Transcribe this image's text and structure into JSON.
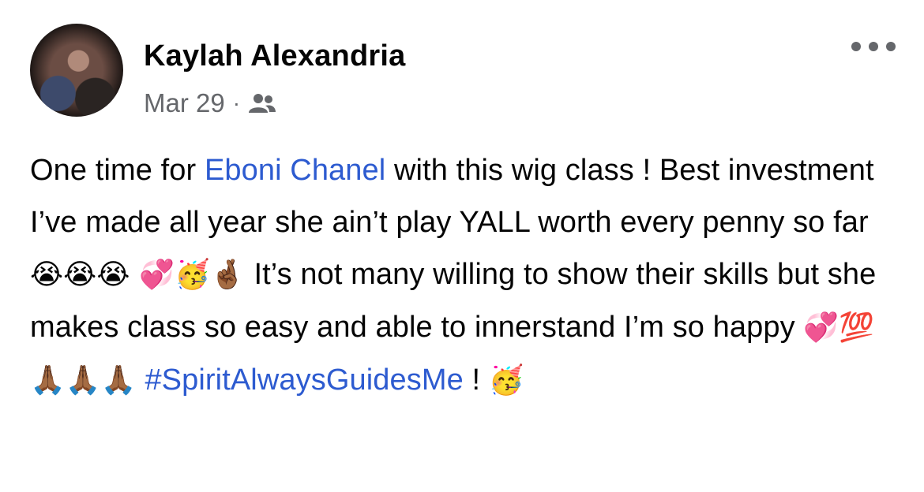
{
  "post": {
    "author": "Kaylah Alexandria",
    "date": "Mar 29",
    "separator": "·",
    "audience_icon": "friends-icon",
    "more_icon": "more-horizontal-icon",
    "text_segments": {
      "s1": "One time for ",
      "mention": "Eboni Chanel",
      "s2": " with this wig class ! Best investment I’ve made all year she ain’t play YALL worth every penny so far ",
      "e1": "😭😭😭 💞🥳🤞🏾",
      "s3": " It’s not many willing to show their skills but she makes class so easy and able to innerstand I’m so happy ",
      "e2": "💞💯🙏🏾🙏🏾🙏🏾",
      "hashtag": "#SpiritAlwaysGuidesMe",
      "s4": " ! ",
      "e3": "🥳"
    }
  }
}
